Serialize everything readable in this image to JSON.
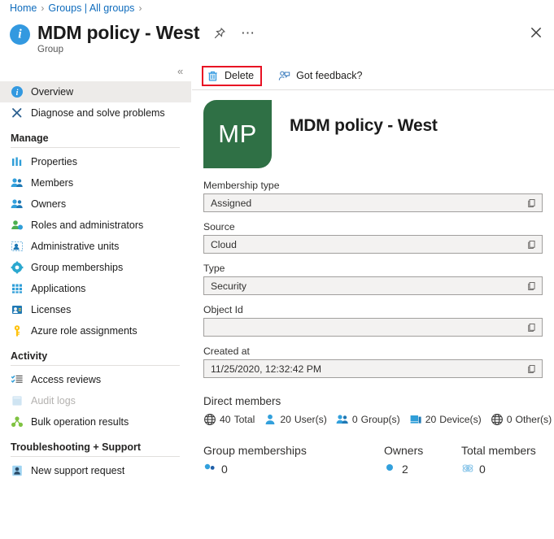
{
  "breadcrumb": {
    "items": [
      "Home",
      "Groups | All groups"
    ],
    "separator": "›",
    "trailing_separator": "›"
  },
  "header": {
    "title": "MDM policy - West",
    "subtitle": "Group",
    "pin_icon": "pin-icon",
    "more_icon": "ellipsis-icon",
    "close_icon": "close-icon",
    "info_icon": "info-icon",
    "collapse_icon": "chevron-double-left-icon"
  },
  "sidebar": {
    "collapse_label": "«",
    "items": [
      {
        "label": "Overview",
        "icon": "info-icon",
        "selected": true,
        "disabled": false
      },
      {
        "label": "Diagnose and solve problems",
        "icon": "wrench-icon",
        "selected": false,
        "disabled": false
      }
    ],
    "groups": [
      {
        "title": "Manage",
        "items": [
          {
            "label": "Properties",
            "icon": "properties-icon",
            "disabled": false
          },
          {
            "label": "Members",
            "icon": "members-icon",
            "disabled": false
          },
          {
            "label": "Owners",
            "icon": "owners-icon",
            "disabled": false
          },
          {
            "label": "Roles and administrators",
            "icon": "roles-icon",
            "disabled": false
          },
          {
            "label": "Administrative units",
            "icon": "administrative-units-icon",
            "disabled": false
          },
          {
            "label": "Group memberships",
            "icon": "gear-icon",
            "disabled": false
          },
          {
            "label": "Applications",
            "icon": "applications-grid-icon",
            "disabled": false
          },
          {
            "label": "Licenses",
            "icon": "licenses-icon",
            "disabled": false
          },
          {
            "label": "Azure role assignments",
            "icon": "key-icon",
            "disabled": false
          }
        ]
      },
      {
        "title": "Activity",
        "items": [
          {
            "label": "Access reviews",
            "icon": "checklist-icon",
            "disabled": false
          },
          {
            "label": "Audit logs",
            "icon": "audit-logs-icon",
            "disabled": true
          },
          {
            "label": "Bulk operation results",
            "icon": "bulk-operations-icon",
            "disabled": false
          }
        ]
      },
      {
        "title": "Troubleshooting + Support",
        "items": [
          {
            "label": "New support request",
            "icon": "support-person-icon",
            "disabled": false
          }
        ]
      }
    ]
  },
  "command_bar": {
    "delete": {
      "label": "Delete",
      "icon": "trash-icon",
      "highlighted": true,
      "highlight_color": "#e81123"
    },
    "feedback": {
      "label": "Got feedback?",
      "icon": "feedback-icon"
    }
  },
  "group_card": {
    "initials": "MP",
    "avatar_color": "#2f7045",
    "name": "MDM policy - West"
  },
  "fields": [
    {
      "label": "Membership type",
      "value": "Assigned",
      "copy_icon": "copy-icon"
    },
    {
      "label": "Source",
      "value": "Cloud",
      "copy_icon": "copy-icon"
    },
    {
      "label": "Type",
      "value": "Security",
      "copy_icon": "copy-icon"
    },
    {
      "label": "Object Id",
      "value": "",
      "copy_icon": "copy-icon"
    },
    {
      "label": "Created at",
      "value": "11/25/2020, 12:32:42 PM",
      "copy_icon": "copy-icon"
    }
  ],
  "direct_members": {
    "title": "Direct members",
    "stats": [
      {
        "count": "40",
        "label": "Total",
        "icon": "globe-icon"
      },
      {
        "count": "20",
        "label": "User(s)",
        "icon": "user-icon"
      },
      {
        "count": "0",
        "label": "Group(s)",
        "icon": "group-icon"
      },
      {
        "count": "20",
        "label": "Device(s)",
        "icon": "device-icon"
      },
      {
        "count": "0",
        "label": "Other(s)",
        "icon": "globe-icon"
      }
    ]
  },
  "summary_cards": [
    {
      "title": "Group memberships",
      "value": "0",
      "icon": "group-dots-icon"
    },
    {
      "title": "Owners",
      "value": "2",
      "icon": "owner-dot-icon"
    },
    {
      "title": "Total members",
      "value": "0",
      "icon": "total-members-icon"
    }
  ]
}
